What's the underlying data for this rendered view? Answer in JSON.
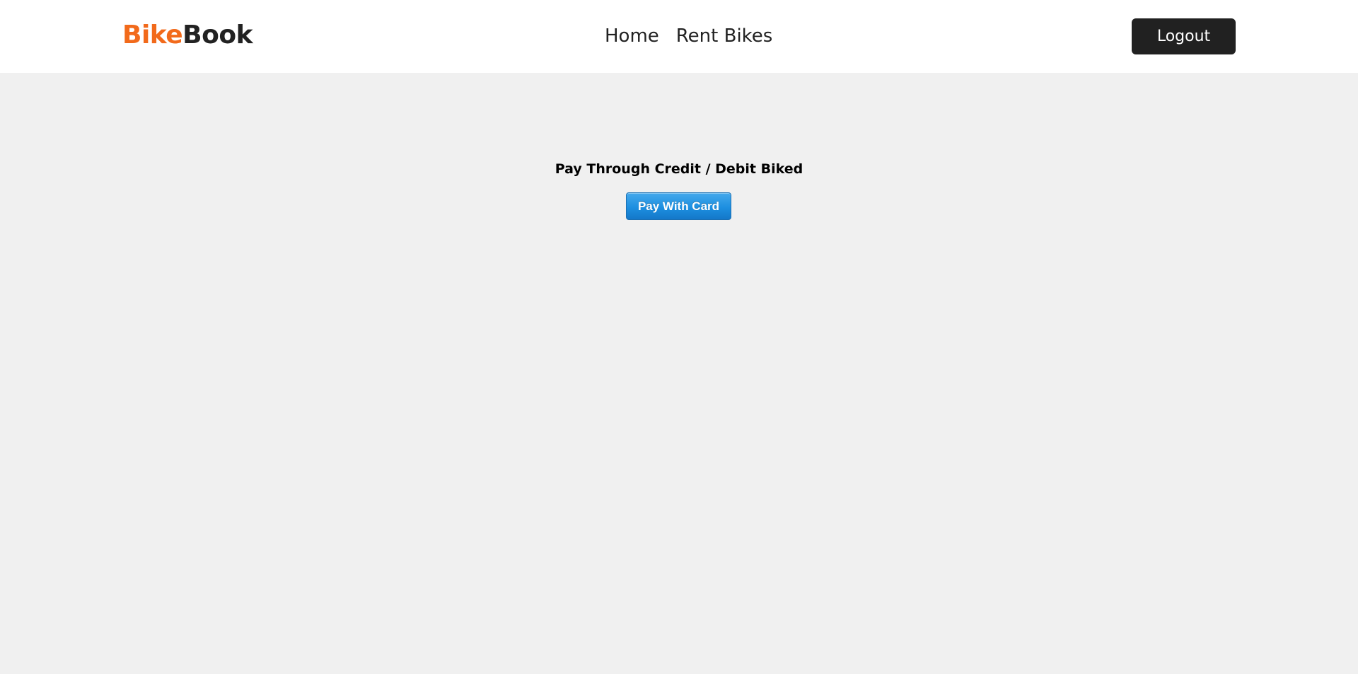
{
  "header": {
    "brand": {
      "part1": "Bike",
      "part2": "Book"
    },
    "nav": [
      {
        "label": "Home"
      },
      {
        "label": "Rent Bikes"
      }
    ],
    "logout_label": "Logout"
  },
  "main": {
    "heading": "Pay Through Credit / Debit Biked",
    "pay_button_label": "Pay With Card"
  },
  "colors": {
    "brand_accent": "#f26a1b",
    "brand_dark": "#222222",
    "logout_bg": "#212121",
    "pay_button": "#1d8fe0",
    "page_bg": "#f0f0f0"
  }
}
